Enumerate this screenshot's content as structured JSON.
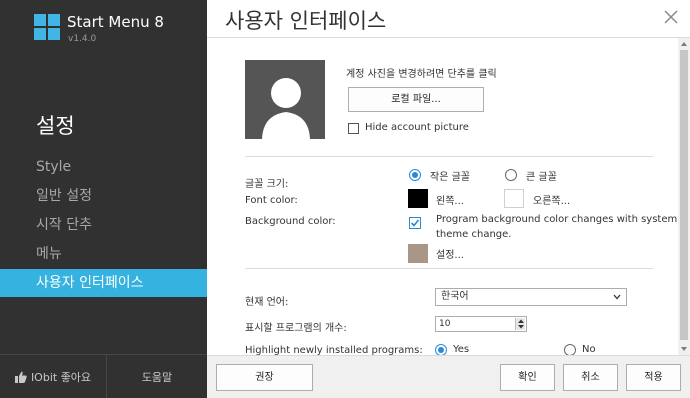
{
  "app": {
    "name": "Start Menu 8",
    "version": "v1.4.0"
  },
  "sidebar": {
    "title": "설정",
    "items": [
      {
        "label": "Style"
      },
      {
        "label": "일반 설정"
      },
      {
        "label": "시작 단추"
      },
      {
        "label": "메뉴"
      },
      {
        "label": "사용자 인터페이스"
      }
    ],
    "active_index": 4,
    "like_label": "IObit 좋아요",
    "help_label": "도움말"
  },
  "main": {
    "title": "사용자 인터페이스",
    "account": {
      "hint": "계정 사진을 변경하려면 단추를 클릭",
      "local_file_button": "로컬 파일...",
      "hide_picture_label": "Hide account picture",
      "hide_picture_checked": false
    },
    "appearance": {
      "font_size_label": "글꼴 크기:",
      "font_size_small": "작은 글꼴",
      "font_size_large": "큰 글꼴",
      "font_size_selected": "small",
      "font_color_label": "Font color:",
      "font_color_left_label": "왼쪽...",
      "font_color_right_label": "오른쪽...",
      "font_color_left": "#000000",
      "font_color_right": "#ffffff",
      "bg_color_label": "Background color:",
      "bg_option_line1": "Program background color changes with system",
      "bg_option_line2": "theme change.",
      "bg_option_checked": true,
      "bg_settings_label": "설정...",
      "bg_swatch_color": "#a89686"
    },
    "language": {
      "label": "현재 언어:",
      "value": "한국어"
    },
    "programs": {
      "label": "표시할 프로그램의 개수:",
      "value": "10"
    },
    "highlight": {
      "label": "Highlight newly installed programs:",
      "yes": "Yes",
      "no": "No",
      "selected": "yes"
    }
  },
  "footer": {
    "recommend": "권장",
    "ok": "확인",
    "cancel": "취소",
    "apply": "적용"
  },
  "colors": {
    "sidebar_bg": "#313131",
    "accent": "#35b2e0",
    "logo": "#41b6e6"
  }
}
